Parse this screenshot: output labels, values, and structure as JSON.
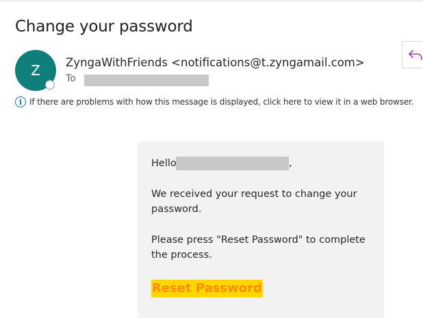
{
  "email": {
    "subject": "Change your password",
    "sender": {
      "avatar_initial": "Z",
      "display": "ZyngaWithFriends <notifications@t.zyngamail.com>"
    },
    "to_label": "To",
    "info_bar": {
      "icon": "info-icon",
      "text": "If there are problems with how this message is displayed, click here to view it in a web browser."
    },
    "reply_icon": "reply-arrow-icon",
    "body": {
      "greeting": "Hello",
      "greeting_suffix": ",",
      "paragraph1": "We received your request to change your password.",
      "paragraph2": "Please press \"Reset Password\" to complete the process.",
      "button_label": "Reset Password"
    }
  },
  "colors": {
    "avatar_bg": "#0f7f7c",
    "card_bg": "#f2f2f2",
    "button_bg": "#ffd700",
    "button_text": "#ff8c00",
    "reply_icon": "#9b3fa6",
    "info_icon": "#1d6fb8",
    "redaction": "#c8c8c8"
  }
}
